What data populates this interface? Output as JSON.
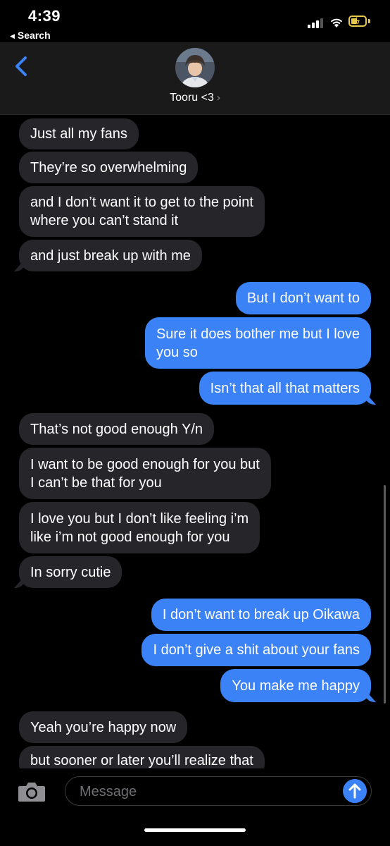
{
  "status_bar": {
    "time": "4:39",
    "back_app": "Search"
  },
  "header": {
    "contact_name": "Tooru <3",
    "chevron": "›"
  },
  "messages": [
    {
      "from": "them",
      "text": [
        "Just all my fans"
      ]
    },
    {
      "from": "them",
      "text": [
        "They’re so overwhelming"
      ]
    },
    {
      "from": "them",
      "text": [
        "and I don’t want it to get to the point",
        "where you can’t stand it"
      ]
    },
    {
      "from": "them",
      "text": [
        "and just break up with me"
      ]
    },
    {
      "from": "me",
      "text": [
        "But I don’t want to"
      ]
    },
    {
      "from": "me",
      "text": [
        "Sure it does bother me but I love",
        "you so"
      ]
    },
    {
      "from": "me",
      "text": [
        "Isn’t that all that matters"
      ]
    },
    {
      "from": "them",
      "text": [
        "That’s not good enough Y/n"
      ]
    },
    {
      "from": "them",
      "text": [
        "I want to be good enough for you but",
        "I can’t be that for you"
      ]
    },
    {
      "from": "them",
      "text": [
        "I love you but I don’t like feeling i’m",
        "like i’m not good enough for you"
      ]
    },
    {
      "from": "them",
      "text": [
        "In sorry cutie"
      ]
    },
    {
      "from": "me",
      "text": [
        "I don’t want to break up Oikawa"
      ]
    },
    {
      "from": "me",
      "text": [
        "I don’t give a shit about your fans"
      ]
    },
    {
      "from": "me",
      "text": [
        "You make me happy"
      ]
    },
    {
      "from": "them",
      "text": [
        "Yeah you’re happy now"
      ]
    },
    {
      "from": "them",
      "text": [
        "but sooner or later you’ll realize that"
      ]
    }
  ],
  "composer": {
    "placeholder": "Message"
  },
  "icons": {
    "back": "chevron-left-icon",
    "camera": "camera-icon",
    "send": "arrow-up-icon"
  },
  "colors": {
    "sent_bubble": "#3b82f6",
    "received_bubble": "#26252a",
    "accent": "#3b82f6"
  }
}
